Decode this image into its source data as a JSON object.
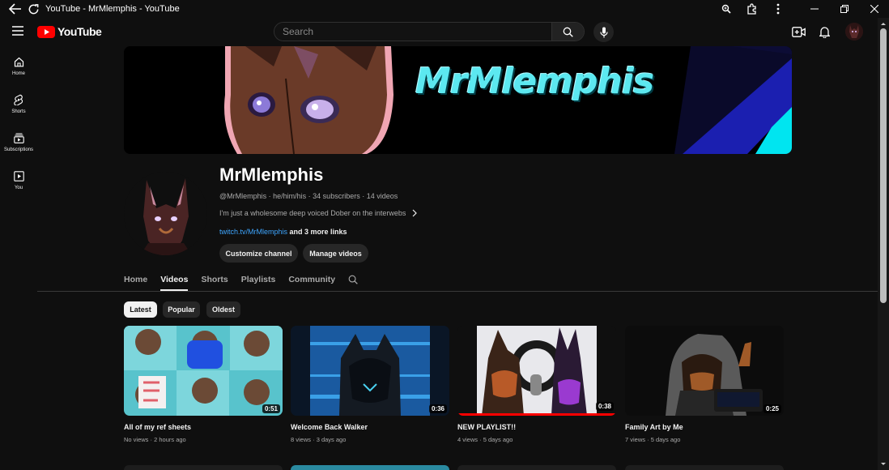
{
  "browser": {
    "tab_title": "YouTube - MrMlemphis - YouTube"
  },
  "masthead": {
    "logo_text": "YouTube",
    "search_placeholder": "Search"
  },
  "guide": {
    "items": [
      {
        "label": "Home"
      },
      {
        "label": "Shorts"
      },
      {
        "label": "Subscriptions"
      },
      {
        "label": "You"
      }
    ]
  },
  "banner": {
    "title": "MrMlemphis"
  },
  "channel": {
    "name": "MrMlemphis",
    "handle": "@MrMlemphis",
    "pronouns": "he/him/his",
    "subscribers": "34 subscribers",
    "videos_count": "14 videos",
    "description": "I'm just a wholesome deep voiced Dober on the interwebs",
    "link": "twitch.tv/MrMlemphis",
    "more_links": "and 3 more links",
    "customize_label": "Customize channel",
    "manage_label": "Manage videos"
  },
  "tabs": [
    {
      "label": "Home",
      "active": false
    },
    {
      "label": "Videos",
      "active": true
    },
    {
      "label": "Shorts",
      "active": false
    },
    {
      "label": "Playlists",
      "active": false
    },
    {
      "label": "Community",
      "active": false
    }
  ],
  "chips": [
    {
      "label": "Latest",
      "selected": true
    },
    {
      "label": "Popular",
      "selected": false
    },
    {
      "label": "Oldest",
      "selected": false
    }
  ],
  "videos": [
    {
      "title": "All of my ref sheets",
      "views": "No views",
      "age": "2 hours ago",
      "duration": "0:51",
      "watched_fraction": 0
    },
    {
      "title": "Welcome Back Walker",
      "views": "8 views",
      "age": "3 days ago",
      "duration": "0:36",
      "watched_fraction": 0
    },
    {
      "title": "NEW PLAYLIST!!",
      "views": "4 views",
      "age": "5 days ago",
      "duration": "0:38",
      "watched_fraction": 1.0
    },
    {
      "title": "Family Art by Me",
      "views": "7 views",
      "age": "5 days ago",
      "duration": "0:25",
      "watched_fraction": 0
    }
  ],
  "colors": {
    "background": "#0f0f0f",
    "brand_red": "#ff0000",
    "link_blue": "#3ea6ff",
    "banner_text": "#5ce8f0",
    "banner_accent": "#1b1fb0"
  }
}
